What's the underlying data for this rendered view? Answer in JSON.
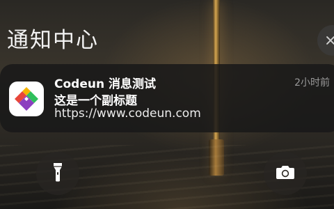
{
  "header": {
    "title": "通知中心"
  },
  "notification": {
    "app_icon": "codeun-app-icon",
    "title": "Codeun 消息测试",
    "subtitle": "这是一个副标题",
    "body": "https://www.codeun.com",
    "time": "2小时前"
  },
  "controls": {
    "flashlight_icon": "flashlight-icon",
    "camera_icon": "camera-icon",
    "close_icon": "close-icon"
  },
  "colors": {
    "card_background": "#181818",
    "logo_red": "#e8463a",
    "logo_yellow": "#f5b400",
    "logo_green": "#2fbf5b",
    "logo_purple": "#8c3fbf"
  }
}
